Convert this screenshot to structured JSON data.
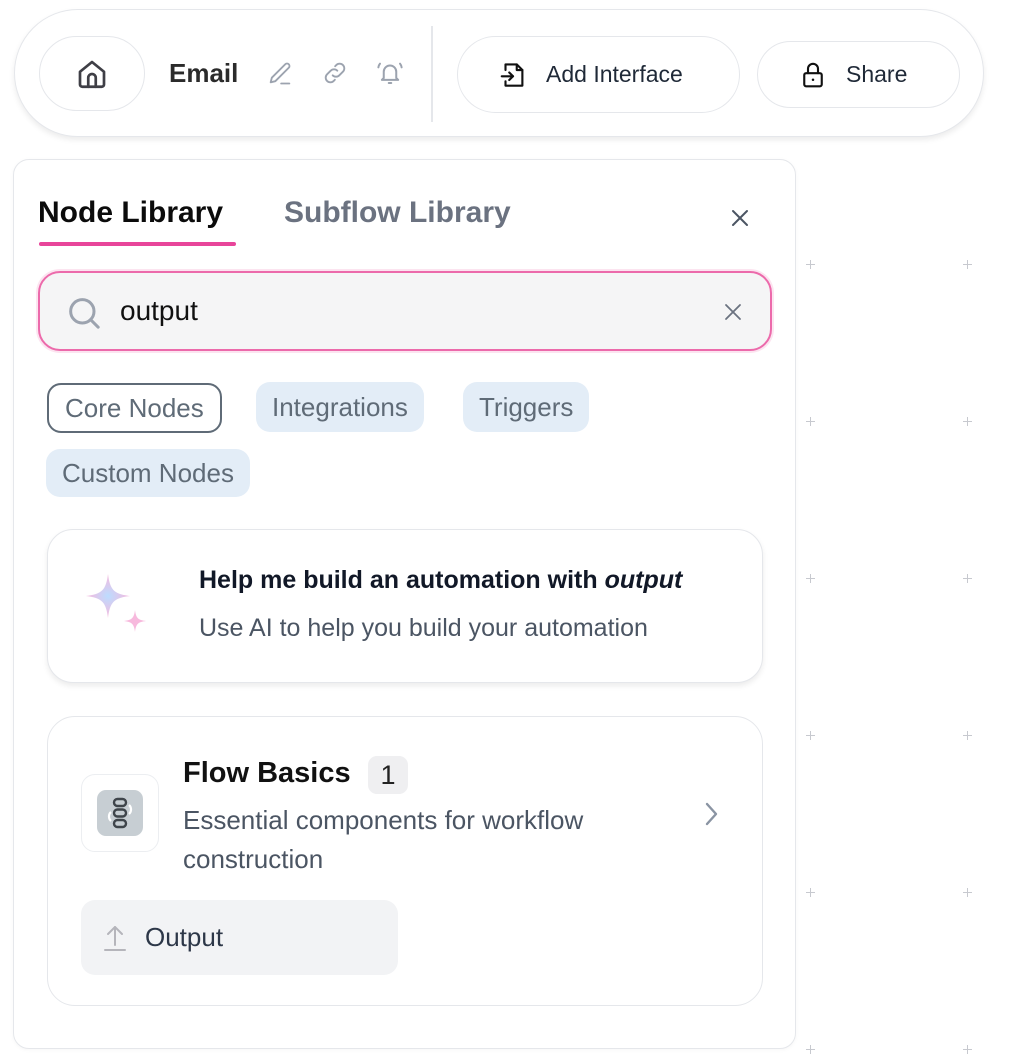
{
  "toolbar": {
    "home_icon": "home-icon",
    "workflow_title": "Email",
    "edit_icon": "pencil-icon",
    "link_icon": "link-icon",
    "bell_icon": "bell-ringing-icon",
    "add_interface": {
      "label": "Add Interface",
      "icon": "file-import-icon"
    },
    "share": {
      "label": "Share",
      "icon": "lock-icon"
    }
  },
  "panel": {
    "tabs": [
      {
        "label": "Node Library",
        "active": true
      },
      {
        "label": "Subflow Library",
        "active": false
      }
    ],
    "close_icon": "close-icon",
    "search": {
      "value": "output",
      "placeholder": "",
      "icon": "search-icon",
      "clear_icon": "clear-icon"
    },
    "filters": [
      {
        "label": "Core Nodes",
        "active": true
      },
      {
        "label": "Integrations",
        "active": false
      },
      {
        "label": "Triggers",
        "active": false
      },
      {
        "label": "Custom Nodes",
        "active": false
      }
    ],
    "ai_suggestion": {
      "icon": "sparkle-icon",
      "title_prefix": "Help me build an automation with ",
      "title_query": "output",
      "subtitle": "Use AI to help you build your automation"
    },
    "categories": [
      {
        "title": "Flow Basics",
        "count": "1",
        "description": "Essential components for workflow construction",
        "icon": "flow-chain-icon",
        "nodes": [
          {
            "label": "Output",
            "icon": "upload-arrow-icon"
          }
        ]
      }
    ]
  },
  "colors": {
    "accent": "#e8459a",
    "search_border": "#ec6aab",
    "chip_bg": "#e3edf7",
    "chip_text": "#5f6b77"
  }
}
